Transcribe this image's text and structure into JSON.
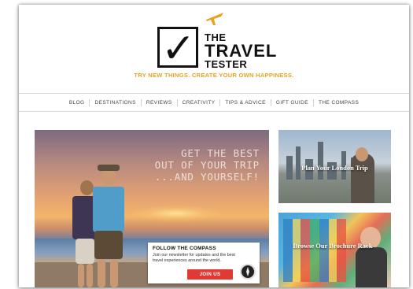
{
  "logo": {
    "line1": "THE",
    "line2": "TRAVEL",
    "line3": "TESTER"
  },
  "tagline": "TRY NEW THINGS. CREATE YOUR OWN HAPPINESS.",
  "nav": [
    "BLOG",
    "DESTINATIONS",
    "REVIEWS",
    "CREATIVITY",
    "TIPS & ADVICE",
    "GIFT GUIDE",
    "THE COMPASS"
  ],
  "hero": {
    "headline": [
      "GET THE BEST",
      "OUT OF YOUR TRIP",
      "...AND YOURSELF!"
    ],
    "promo": {
      "title": "FOLLOW THE COMPASS",
      "text": "Join our newsletter for updates and the best travel experiences around the world.",
      "button": "JOIN US"
    }
  },
  "cards": [
    {
      "label": "Plan Your London Trip"
    },
    {
      "label": "Browse Our Brochure Rack"
    }
  ],
  "colors": {
    "accent": "#e8a21f",
    "button": "#e03a34"
  }
}
